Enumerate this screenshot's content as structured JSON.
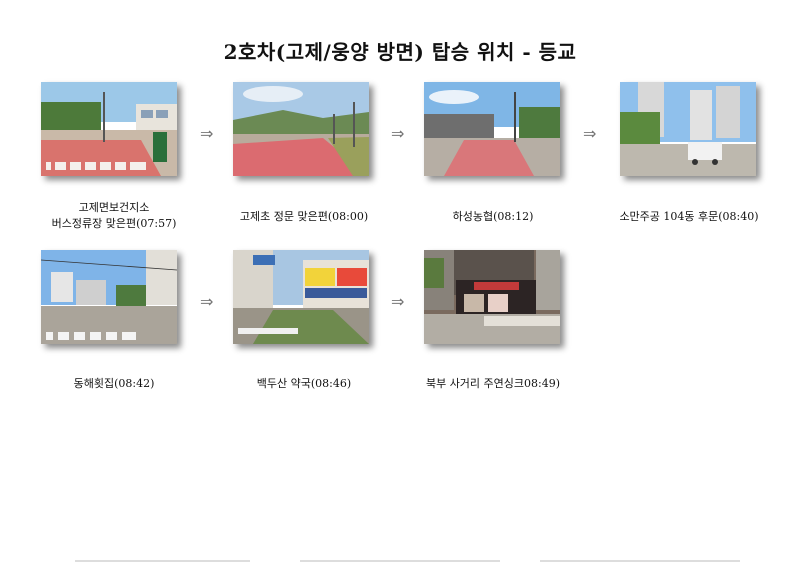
{
  "title": "2호차(고제/웅양 방면) 탑승 위치 - 등교",
  "arrow_symbol": "⇒",
  "stops": [
    {
      "line1": "고제면보건지소",
      "line2": "버스정류장 맞은편(07:57)"
    },
    {
      "line1": "고제초 정문 맞은편(08:00)"
    },
    {
      "line1": "하성농협(08:12)"
    },
    {
      "line1": "소만주공 104동 후문(08:40)"
    },
    {
      "line1": "동해횟집(08:42)"
    },
    {
      "line1": "백두산 약국(08:46)"
    },
    {
      "line1": "북부 사거리 주연싱크08:49)"
    }
  ]
}
